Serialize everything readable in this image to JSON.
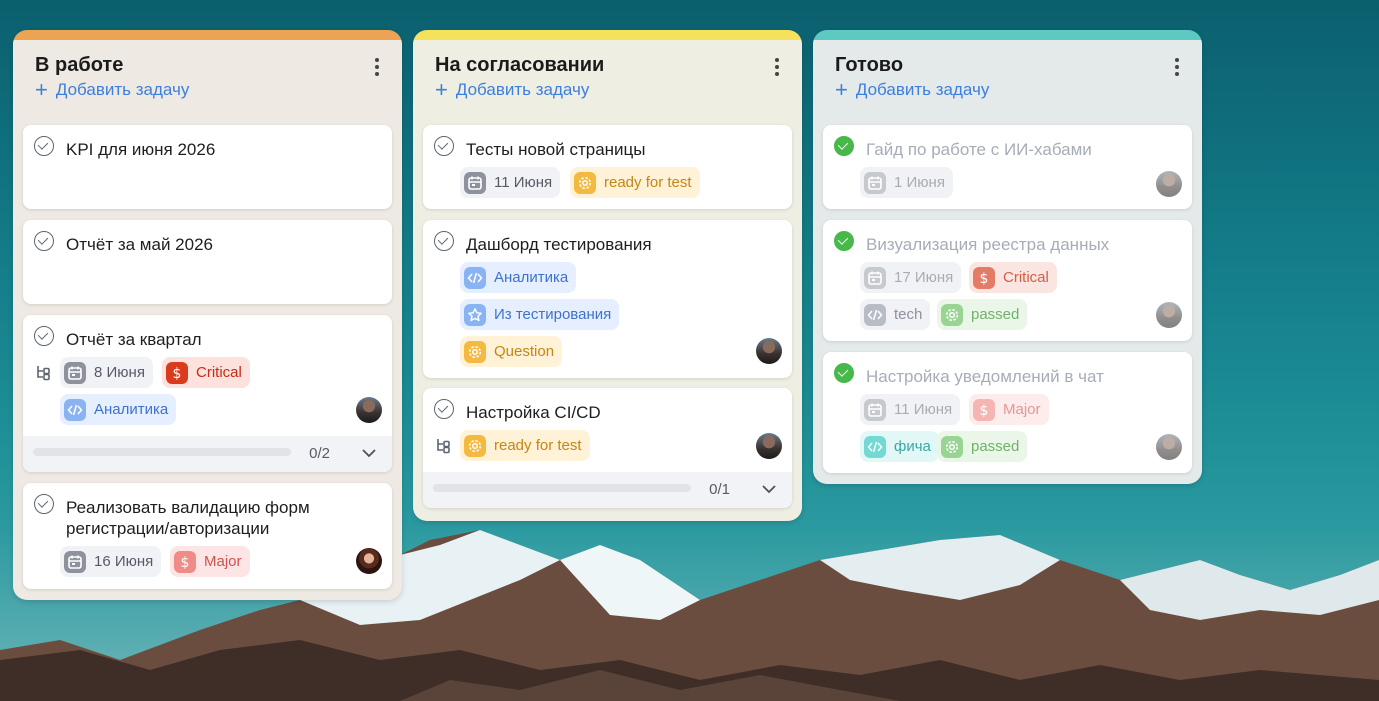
{
  "colors": {
    "col1_accent": "#eca353",
    "col1_bg": "#efe9e3",
    "col2_accent": "#f5e25b",
    "col2_bg": "#eeeee3",
    "col3_accent": "#5dc9c1",
    "col3_bg": "#e4eaea"
  },
  "columns": [
    {
      "title": "В работе",
      "add_label": "Добавить задачу",
      "cards": [
        {
          "title": "KPI для июня 2026"
        },
        {
          "title": "Отчёт за май 2026"
        },
        {
          "title": "Отчёт за квартал",
          "date": "8 Июня",
          "priority": "Critical",
          "tag": "Аналитика",
          "progress": "0/2"
        },
        {
          "title": "Реализовать валидацию форм регистрации/авторизации",
          "date": "16 Июня",
          "priority": "Major"
        }
      ]
    },
    {
      "title": "На согласовании",
      "add_label": "Добавить задачу",
      "cards": [
        {
          "title": "Тесты новой страницы",
          "date": "11 Июня",
          "status": "ready for test"
        },
        {
          "title": "Дашборд тестирования",
          "tags": [
            "Аналитика",
            "Из тестирования",
            "Question"
          ]
        },
        {
          "title": "Настройка CI/CD",
          "status": "ready for test",
          "progress": "0/1"
        }
      ]
    },
    {
      "title": "Готово",
      "add_label": "Добавить задачу",
      "cards": [
        {
          "title": "Гайд по работе с ИИ-хабами",
          "date": "1 Июня"
        },
        {
          "title": "Визуализация реестра данных",
          "date": "17 Июня",
          "priority": "Critical",
          "tags": [
            "tech",
            "passed"
          ]
        },
        {
          "title": "Настройка уведомлений в чат",
          "date": "11 Июня",
          "priority": "Major",
          "tags": [
            "фича",
            "passed"
          ]
        }
      ]
    }
  ]
}
